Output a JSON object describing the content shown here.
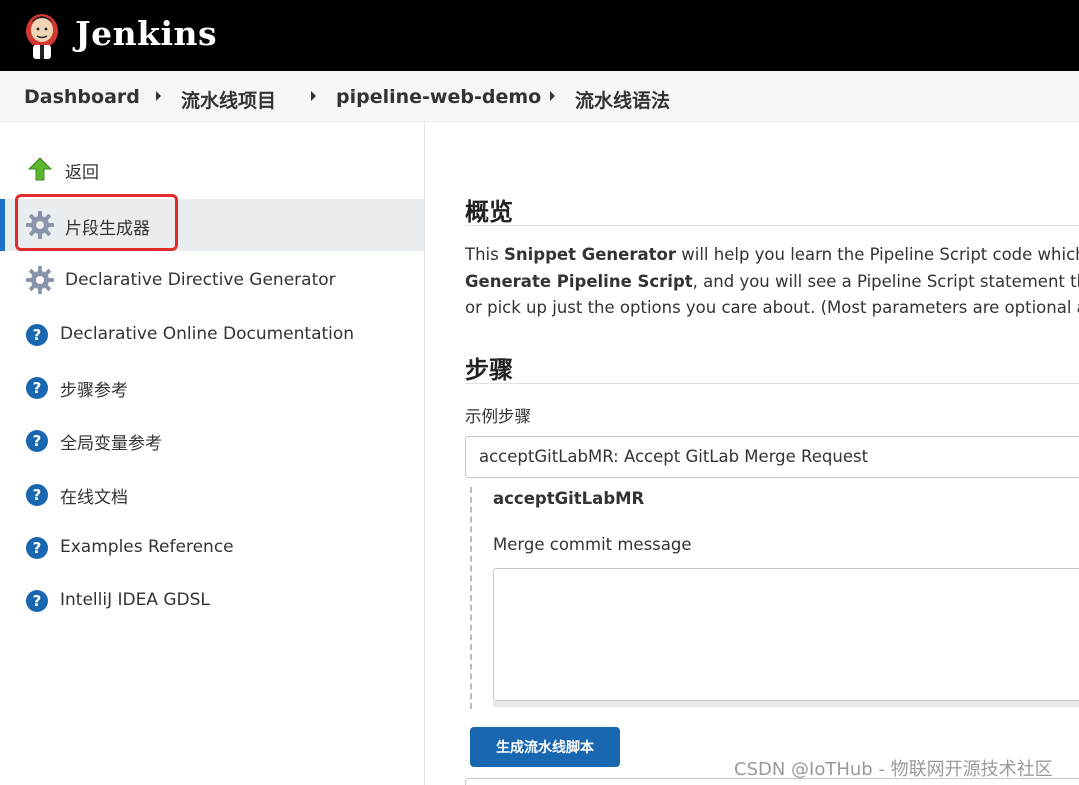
{
  "header": {
    "logo_text": "Jenkins",
    "bg_color": "#000000"
  },
  "breadcrumb": {
    "items": [
      "Dashboard",
      "流水线项目",
      "pipeline-web-demo",
      "流水线语法"
    ]
  },
  "sidebar": {
    "items": [
      {
        "label": "返回",
        "icon": "up-arrow-icon"
      },
      {
        "label": "片段生成器",
        "icon": "gear-icon",
        "active": true
      },
      {
        "label": "Declarative Directive Generator",
        "icon": "gear-icon"
      },
      {
        "label": "Declarative Online Documentation",
        "icon": "help-icon"
      },
      {
        "label": "步骤参考",
        "icon": "help-icon"
      },
      {
        "label": "全局变量参考",
        "icon": "help-icon"
      },
      {
        "label": "在线文档",
        "icon": "help-icon"
      },
      {
        "label": "Examples Reference",
        "icon": "help-icon"
      },
      {
        "label": "IntelliJ IDEA GDSL",
        "icon": "help-icon"
      }
    ],
    "accent_color": "#1b70c8",
    "highlight_color": "#e32b2b"
  },
  "main": {
    "overview_title": "概览",
    "desc_line1_prefix": "This ",
    "desc_line1_bold": "Snippet Generator",
    "desc_line1_rest": " will help you learn the Pipeline Script code which can b",
    "desc_line2_bold": "Generate Pipeline Script",
    "desc_line2_rest": ", and you will see a Pipeline Script statement that wou",
    "desc_line3": "or pick up just the options you care about. (Most parameters are optional and ca",
    "steps_title": "步骤",
    "sample_step_label": "示例步骤",
    "sample_step_value": "acceptGitLabMR: Accept GitLab Merge Request",
    "step_name": "acceptGitLabMR",
    "merge_commit_label": "Merge commit message",
    "merge_commit_value": "",
    "generate_button": "生成流水线脚本",
    "button_color": "#1867b0"
  },
  "watermark": "CSDN @IoTHub - 物联网开源技术社区"
}
